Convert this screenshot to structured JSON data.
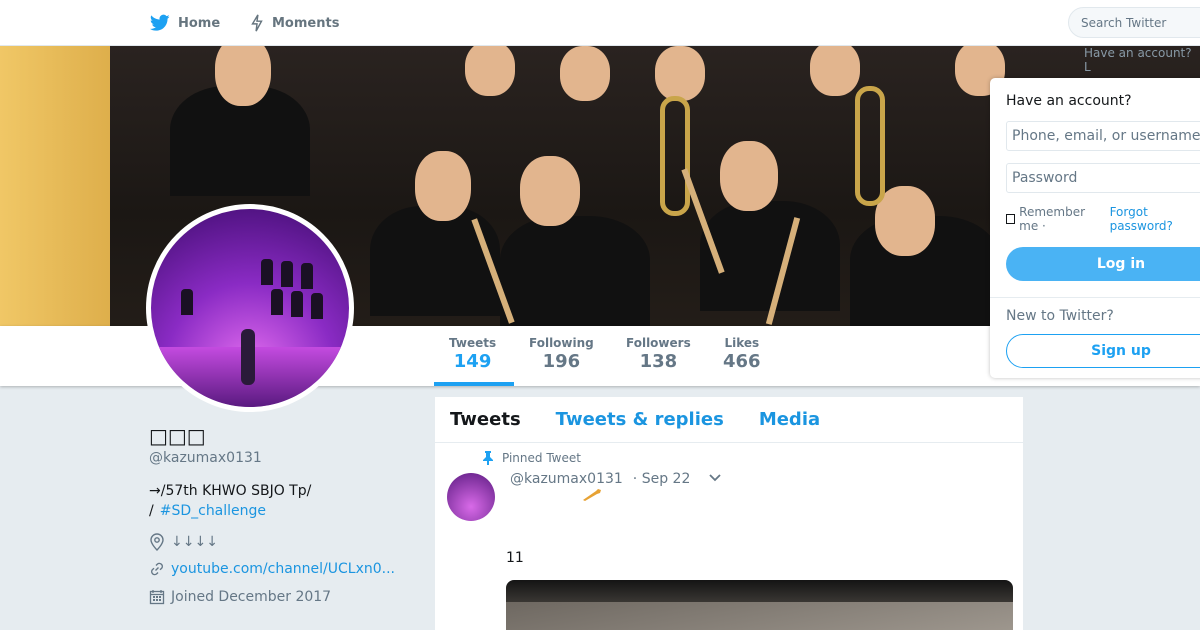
{
  "topnav": {
    "home_label": "Home",
    "moments_label": "Moments",
    "search_placeholder": "Search Twitter",
    "have_account_partial": "Have an account? L"
  },
  "profile": {
    "name": "□□□",
    "handle": "@kazumax0131",
    "bio_line1": "→/57th KHWO SBJO Tp/",
    "bio_line2_prefix": "/",
    "bio_hashtag": "#SD_challenge",
    "location": "↓↓↓↓",
    "website": "youtube.com/channel/UCLxn0...",
    "joined": "Joined December 2017"
  },
  "stats": [
    {
      "label": "Tweets",
      "value": "149"
    },
    {
      "label": "Following",
      "value": "196"
    },
    {
      "label": "Followers",
      "value": "138"
    },
    {
      "label": "Likes",
      "value": "466"
    }
  ],
  "timeline": {
    "tabs": [
      "Tweets",
      "Tweets & replies",
      "Media"
    ],
    "pinned_label": "Pinned Tweet",
    "tweet": {
      "handle": "@kazumax0131",
      "date": "· Sep 22",
      "text": "11"
    }
  },
  "login": {
    "title": "Have an account?",
    "username_placeholder": "Phone, email, or username",
    "password_placeholder": "Password",
    "remember_label": "Remember me ·",
    "forgot_label": "Forgot password?",
    "login_button": "Log in",
    "new_to": "New to Twitter?",
    "signup_button": "Sign up"
  },
  "colors": {
    "accent": "#1da1f2",
    "link": "#1b95e0",
    "background": "#e6ecf0"
  }
}
